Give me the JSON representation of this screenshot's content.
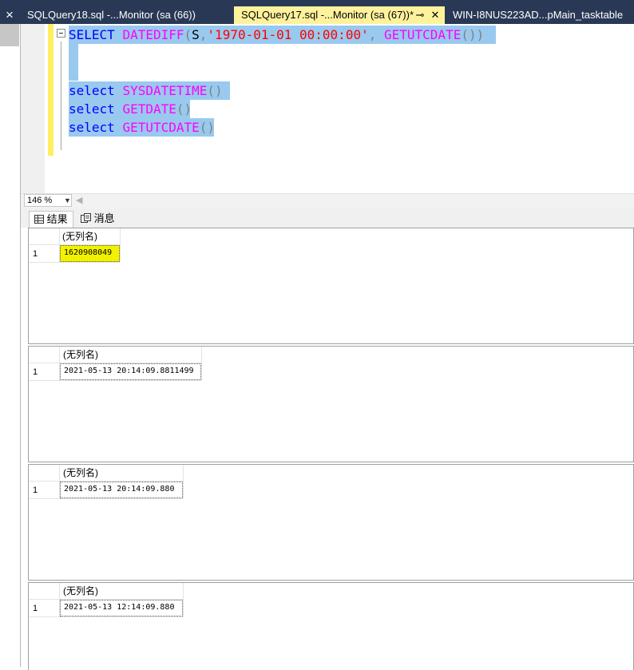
{
  "tabs": [
    {
      "label": "SQLQuery18.sql -...Monitor (sa (66))"
    },
    {
      "label": "SQLQuery17.sql -...Monitor (sa (67))*"
    },
    {
      "label": "WIN-I8NUS223AD...pMain_tasktable"
    }
  ],
  "tab_icons": {
    "close_strip": "×",
    "pin": "⊸",
    "close_tab": "✕"
  },
  "editor": {
    "line1": {
      "kw": "SELECT",
      "fn": "DATEDIFF",
      "p1": "(",
      "arg1": "S",
      "comma": ",",
      "str": "'1970-01-01 00:00:00'",
      "comma2": ",",
      "fn2": "GETUTCDATE",
      "p2": "())"
    },
    "line4": {
      "kw": "select",
      "fn": "SYSDATETIME",
      "p": "()"
    },
    "line5": {
      "kw": "select",
      "fn": "GETDATE",
      "p": "()"
    },
    "line6": {
      "kw": "select",
      "fn": "GETUTCDATE",
      "p": "()"
    }
  },
  "zoom": {
    "value": "146 %"
  },
  "results_tabs": {
    "results": "结果",
    "messages": "消息"
  },
  "grids": [
    {
      "header": "(无列名)",
      "row": "1",
      "value": "1620908049"
    },
    {
      "header": "(无列名)",
      "row": "1",
      "value": "2021-05-13 20:14:09.8811499"
    },
    {
      "header": "(无列名)",
      "row": "1",
      "value": "2021-05-13 20:14:09.880"
    },
    {
      "header": "(无列名)",
      "row": "1",
      "value": "2021-05-13 12:14:09.880"
    }
  ],
  "colors": {
    "tab_strip": "#293955",
    "active_tab": "#fff29d",
    "selection": "#99c9ef",
    "keyword": "#0000ff",
    "function": "#ff00ff",
    "string": "#ff0000"
  }
}
